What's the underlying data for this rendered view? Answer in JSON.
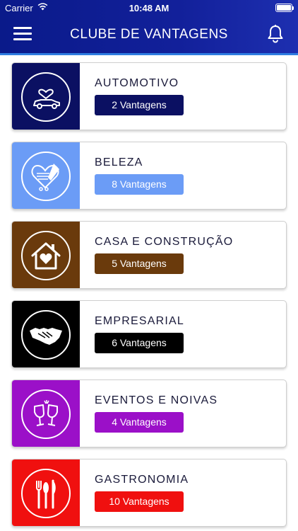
{
  "status_bar": {
    "carrier": "Carrier",
    "time": "10:48 AM"
  },
  "header": {
    "title": "CLUBE DE VANTAGENS"
  },
  "categories": [
    {
      "title": "AUTOMOTIVO",
      "badge": "2 Vantagens",
      "color": "#0b1062",
      "badge_color": "#0b1062",
      "icon": "car-heart-icon"
    },
    {
      "title": "BELEZA",
      "badge": "8 Vantagens",
      "color": "#6b9cf6",
      "badge_color": "#6b9cf6",
      "icon": "beauty-heart-icon"
    },
    {
      "title": "CASA E CONSTRUÇÃO",
      "badge": "5 Vantagens",
      "color": "#6a3a0c",
      "badge_color": "#6a3a0c",
      "icon": "house-heart-icon"
    },
    {
      "title": "EMPRESARIAL",
      "badge": "6 Vantagens",
      "color": "#000000",
      "badge_color": "#000000",
      "icon": "handshake-icon"
    },
    {
      "title": "EVENTOS E NOIVAS",
      "badge": "4 Vantagens",
      "color": "#9b10c8",
      "badge_color": "#9b10c8",
      "icon": "wine-glasses-icon"
    },
    {
      "title": "GASTRONOMIA",
      "badge": "10 Vantagens",
      "color": "#f0100f",
      "badge_color": "#f0100f",
      "icon": "cutlery-icon"
    }
  ]
}
